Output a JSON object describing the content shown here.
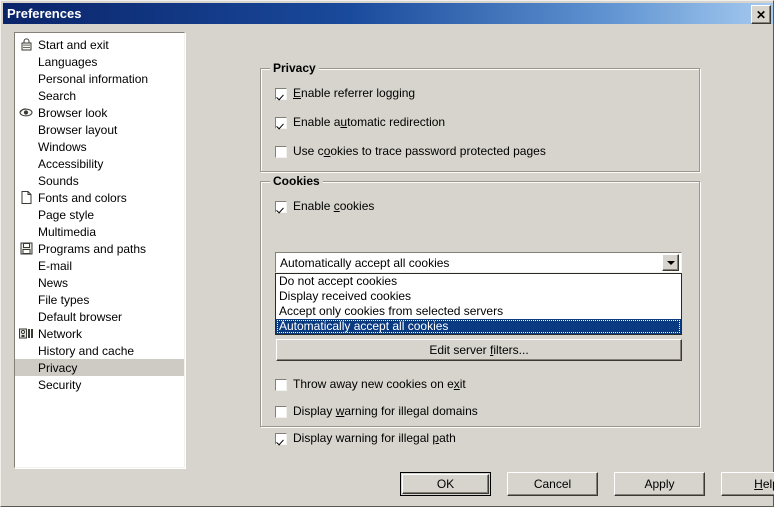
{
  "window": {
    "title": "Preferences",
    "close_label": "✕",
    "colors": {
      "face": "#d6d4cc",
      "title_gradient_start": "#0a246a",
      "title_gradient_end": "#a6caf0",
      "selection": "#0a3a82",
      "list_selection": "#cdcbc4"
    }
  },
  "sidebar": {
    "items": [
      {
        "label": "Start and exit",
        "icon": "lock-icon",
        "selected": false
      },
      {
        "label": "Languages",
        "icon": "",
        "selected": false
      },
      {
        "label": "Personal information",
        "icon": "",
        "selected": false
      },
      {
        "label": "Search",
        "icon": "",
        "selected": false
      },
      {
        "label": "Browser look",
        "icon": "eye-icon",
        "selected": false
      },
      {
        "label": "Browser layout",
        "icon": "",
        "selected": false
      },
      {
        "label": "Windows",
        "icon": "",
        "selected": false
      },
      {
        "label": "Accessibility",
        "icon": "",
        "selected": false
      },
      {
        "label": "Sounds",
        "icon": "",
        "selected": false
      },
      {
        "label": "Fonts and colors",
        "icon": "page-icon",
        "selected": false
      },
      {
        "label": "Page style",
        "icon": "",
        "selected": false
      },
      {
        "label": "Multimedia",
        "icon": "",
        "selected": false
      },
      {
        "label": "Programs and paths",
        "icon": "diskette-icon",
        "selected": false
      },
      {
        "label": "E-mail",
        "icon": "",
        "selected": false
      },
      {
        "label": "News",
        "icon": "",
        "selected": false
      },
      {
        "label": "File types",
        "icon": "",
        "selected": false
      },
      {
        "label": "Default browser",
        "icon": "",
        "selected": false
      },
      {
        "label": "Network",
        "icon": "network-icon",
        "selected": false
      },
      {
        "label": "History and cache",
        "icon": "",
        "selected": false
      },
      {
        "label": "Privacy",
        "icon": "",
        "selected": true
      },
      {
        "label": "Security",
        "icon": "",
        "selected": false
      }
    ]
  },
  "privacy_group": {
    "legend": "Privacy",
    "checkboxes": [
      {
        "label_pre": "",
        "label_mnemonic": "E",
        "label_post": "nable referrer logging",
        "checked": true
      },
      {
        "label_pre": "Enable a",
        "label_mnemonic": "u",
        "label_post": "tomatic redirection",
        "checked": true
      },
      {
        "label_pre": "Use c",
        "label_mnemonic": "o",
        "label_post": "okies to trace password protected pages",
        "checked": false
      }
    ]
  },
  "cookies_group": {
    "legend": "Cookies",
    "enable_checkbox": {
      "label_pre": "Enable ",
      "label_mnemonic": "c",
      "label_post": "ookies",
      "checked": true
    },
    "combo": {
      "value": "Automatically accept all cookies",
      "expanded": true,
      "options": [
        {
          "label": "Do not accept cookies",
          "selected": false
        },
        {
          "label": "Display received cookies",
          "selected": false
        },
        {
          "label": "Accept only cookies from selected servers",
          "selected": false
        },
        {
          "label": "Automatically accept all cookies",
          "selected": true
        }
      ]
    },
    "edit_filters_button": {
      "label_pre": "Edit server ",
      "label_mnemonic": "f",
      "label_post": "ilters..."
    },
    "checkboxes": [
      {
        "label_pre": "Throw away new cookies on e",
        "label_mnemonic": "x",
        "label_post": "it",
        "checked": false
      },
      {
        "label_pre": "Display ",
        "label_mnemonic": "w",
        "label_post": "arning for illegal domains",
        "checked": false
      },
      {
        "label_pre": "Display warning for illegal ",
        "label_mnemonic": "p",
        "label_post": "ath",
        "checked": true
      }
    ]
  },
  "footer": {
    "buttons": [
      {
        "label_pre": "OK",
        "label_mnemonic": "",
        "label_post": "",
        "default": true
      },
      {
        "label_pre": "Cancel",
        "label_mnemonic": "",
        "label_post": "",
        "default": false
      },
      {
        "label_pre": "Apply",
        "label_mnemonic": "",
        "label_post": "",
        "default": false
      },
      {
        "label_pre": "",
        "label_mnemonic": "H",
        "label_post": "elp",
        "default": false
      }
    ]
  }
}
